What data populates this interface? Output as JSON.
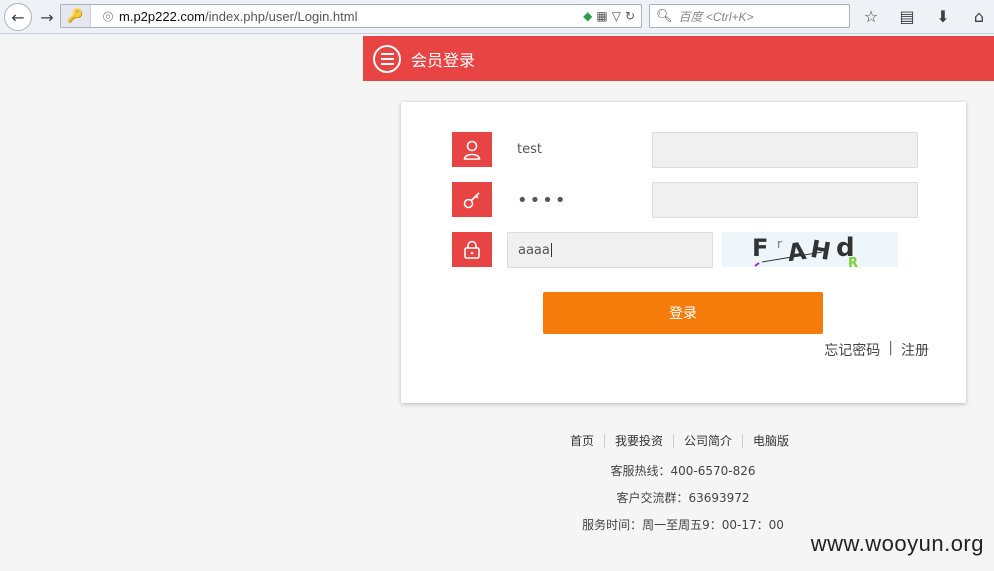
{
  "browser": {
    "url_host": "m.p2p222.com",
    "url_path": "/index.php/user/Login.html",
    "search_placeholder": "百度 <Ctrl+K>"
  },
  "header": {
    "title": "会员登录"
  },
  "form": {
    "username_value": "test",
    "password_mask": "••••",
    "captcha_value": "aaaa",
    "captcha_image_text": "FrAHdR",
    "login_label": "登录",
    "forgot_label": "忘记密码",
    "separator": "|",
    "register_label": "注册"
  },
  "footer": {
    "nav": [
      "首页",
      "我要投资",
      "公司简介",
      "电脑版"
    ],
    "hotline": "客服热线：400-6570-826",
    "group": "客户交流群：63693972",
    "hours": "服务时间：周一至周五9：00-17：00"
  },
  "watermark": "www.wooyun.org",
  "colors": {
    "header_red": "#e84444",
    "button_orange": "#f57c0b"
  }
}
